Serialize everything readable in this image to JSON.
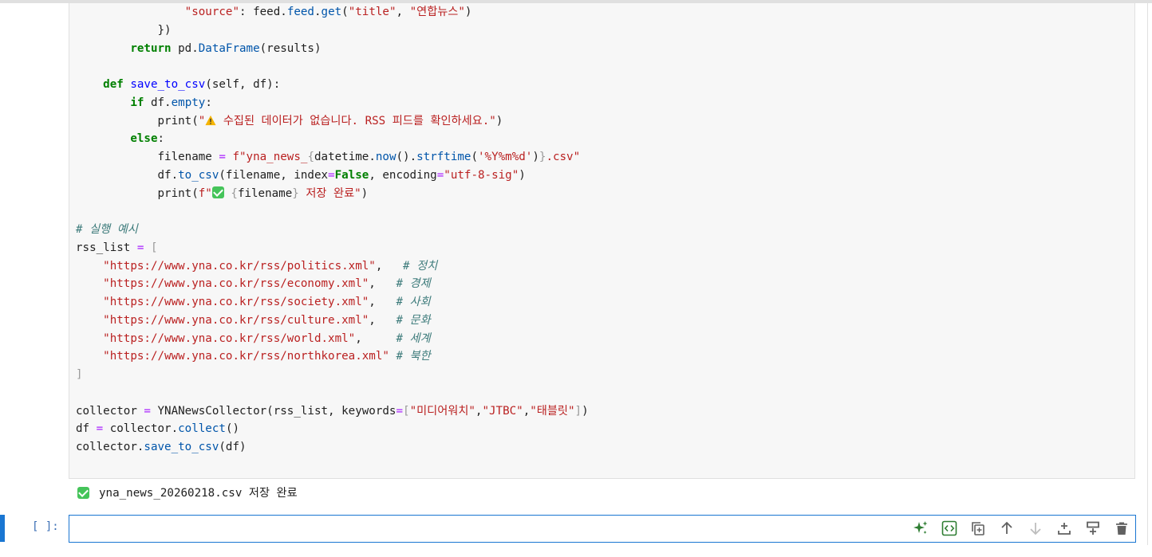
{
  "code_lines": [
    "                \"source\": feed.feed.get(\"title\", \"연합뉴스\")",
    "            })",
    "        return pd.DataFrame(results)",
    "",
    "    def save_to_csv(self, df):",
    "        if df.empty:",
    "            print(\"⚠️ 수집된 데이터가 없습니다. RSS 피드를 확인하세요.\")",
    "        else:",
    "            filename = f\"yna_news_{datetime.now().strftime('%Y%m%d')}.csv\"",
    "            df.to_csv(filename, index=False, encoding=\"utf-8-sig\")",
    "            print(f\"✅ {filename} 저장 완료\")",
    "",
    "# 실행 예시",
    "rss_list = [",
    "    \"https://www.yna.co.kr/rss/politics.xml\",   # 정치",
    "    \"https://www.yna.co.kr/rss/economy.xml\",   # 경제",
    "    \"https://www.yna.co.kr/rss/society.xml\",   # 사회",
    "    \"https://www.yna.co.kr/rss/culture.xml\",   # 문화",
    "    \"https://www.yna.co.kr/rss/world.xml\",     # 세계",
    "    \"https://www.yna.co.kr/rss/northkorea.xml\" # 북한",
    "]",
    "",
    "collector = YNANewsCollector(rss_list, keywords=[\"미디어워치\",\"JTBC\",\"태블릿\"])",
    "df = collector.collect()",
    "collector.save_to_csv(df)"
  ],
  "output": {
    "icon": "check-mark-icon",
    "text": "yna_news_20260218.csv 저장 완료"
  },
  "input_cell": {
    "prompt": "[ ]:",
    "value": ""
  },
  "toolbar": {
    "icons": [
      "sparkle-ai-icon",
      "code-format-icon",
      "duplicate-icon",
      "move-up-icon",
      "move-down-icon",
      "insert-above-icon",
      "insert-below-icon",
      "delete-icon"
    ]
  },
  "colors": {
    "keyword": "#008000",
    "string": "#ba2121",
    "function": "#0000ff",
    "comment": "#3d7b7b",
    "accent": "#1976d2",
    "cell_background": "#f7f7f7"
  }
}
